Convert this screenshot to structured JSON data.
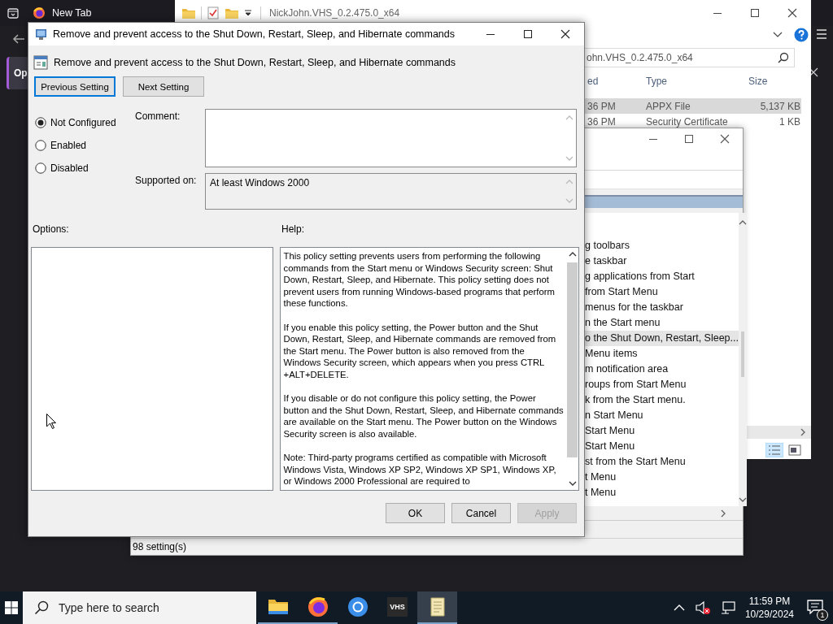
{
  "browser": {
    "tab_title": "New Tab",
    "card_text": "Op"
  },
  "explorer": {
    "title": "NickJohn.VHS_0.2.475.0_x64",
    "search_value": "ohn.VHS_0.2.475.0_x64",
    "columns": [
      "ed",
      "Type",
      "Size"
    ],
    "rows": [
      {
        "cells": [
          "36 PM",
          "APPX File",
          "5,137 KB"
        ],
        "selected": true
      },
      {
        "cells": [
          "36 PM",
          "Security Certificate",
          "1 KB"
        ],
        "selected": false
      }
    ]
  },
  "policy_editor": {
    "items": [
      {
        "label": "g toolbars",
        "selected": false
      },
      {
        "label": "e taskbar",
        "selected": false
      },
      {
        "label": "g applications from Start",
        "selected": false
      },
      {
        "label": "from Start Menu",
        "selected": false
      },
      {
        "label": "menus for the taskbar",
        "selected": false
      },
      {
        "label": "n the Start menu",
        "selected": false
      },
      {
        "label": "o the Shut Down, Restart, Sleep...",
        "selected": true
      },
      {
        "label": "Menu items",
        "selected": false
      },
      {
        "label": "m notification area",
        "selected": false
      },
      {
        "label": "roups from Start Menu",
        "selected": false
      },
      {
        "label": "k from the Start menu.",
        "selected": false
      },
      {
        "label": "n Start Menu",
        "selected": false
      },
      {
        "label": "Start Menu",
        "selected": false
      },
      {
        "label": "Start Menu",
        "selected": false
      },
      {
        "label": "st from the Start Menu",
        "selected": false
      },
      {
        "label": "t Menu",
        "selected": false
      },
      {
        "label": "t Menu",
        "selected": false
      }
    ],
    "status_bar": "98 setting(s)"
  },
  "dialog": {
    "title": "Remove and prevent access to the Shut Down, Restart, Sleep, and Hibernate commands",
    "heading": "Remove and prevent access to the Shut Down, Restart, Sleep, and Hibernate commands",
    "nav_buttons": [
      {
        "label": "Previous Setting",
        "focused": true
      },
      {
        "label": "Next Setting",
        "focused": false
      }
    ],
    "states": [
      {
        "label": "Not Configured",
        "selected": true
      },
      {
        "label": "Enabled",
        "selected": false
      },
      {
        "label": "Disabled",
        "selected": false
      }
    ],
    "comment_label": "Comment:",
    "supported_label": "Supported on:",
    "supported_value": "At least Windows 2000",
    "options_label": "Options:",
    "help_label": "Help:",
    "help_paragraphs": [
      "This policy setting prevents users from performing the following commands from the Start menu or Windows Security screen: Shut Down, Restart, Sleep, and Hibernate. This policy setting does not prevent users from running Windows-based programs that perform these functions.",
      "If you enable this policy setting, the Power button and the Shut Down, Restart, Sleep, and Hibernate commands are removed from the Start menu. The Power button is also removed from the Windows Security screen, which appears when you press CTRL +ALT+DELETE.",
      "If you disable or do not configure this policy setting, the Power button and the Shut Down, Restart, Sleep, and Hibernate commands are available on the Start menu. The Power button on the Windows Security screen is also available.",
      "Note: Third-party programs certified as compatible with Microsoft Windows Vista, Windows XP SP2, Windows XP SP1, Windows XP, or Windows 2000 Professional are required to"
    ],
    "buttons": [
      {
        "label": "OK",
        "disabled": false
      },
      {
        "label": "Cancel",
        "disabled": false
      },
      {
        "label": "Apply",
        "disabled": true
      }
    ]
  },
  "taskbar": {
    "search_placeholder": "Type here to search",
    "apps": [
      {
        "kind": "folder",
        "running": true,
        "active": false
      },
      {
        "kind": "firefox",
        "running": true,
        "active": false
      },
      {
        "kind": "chrome",
        "running": false,
        "active": false
      },
      {
        "kind": "vhs",
        "label": "VHS",
        "running": false,
        "active": false
      },
      {
        "kind": "notepad",
        "running": true,
        "active": true
      }
    ],
    "time": "11:59 PM",
    "date": "10/29/2024",
    "notification_count": "1"
  }
}
